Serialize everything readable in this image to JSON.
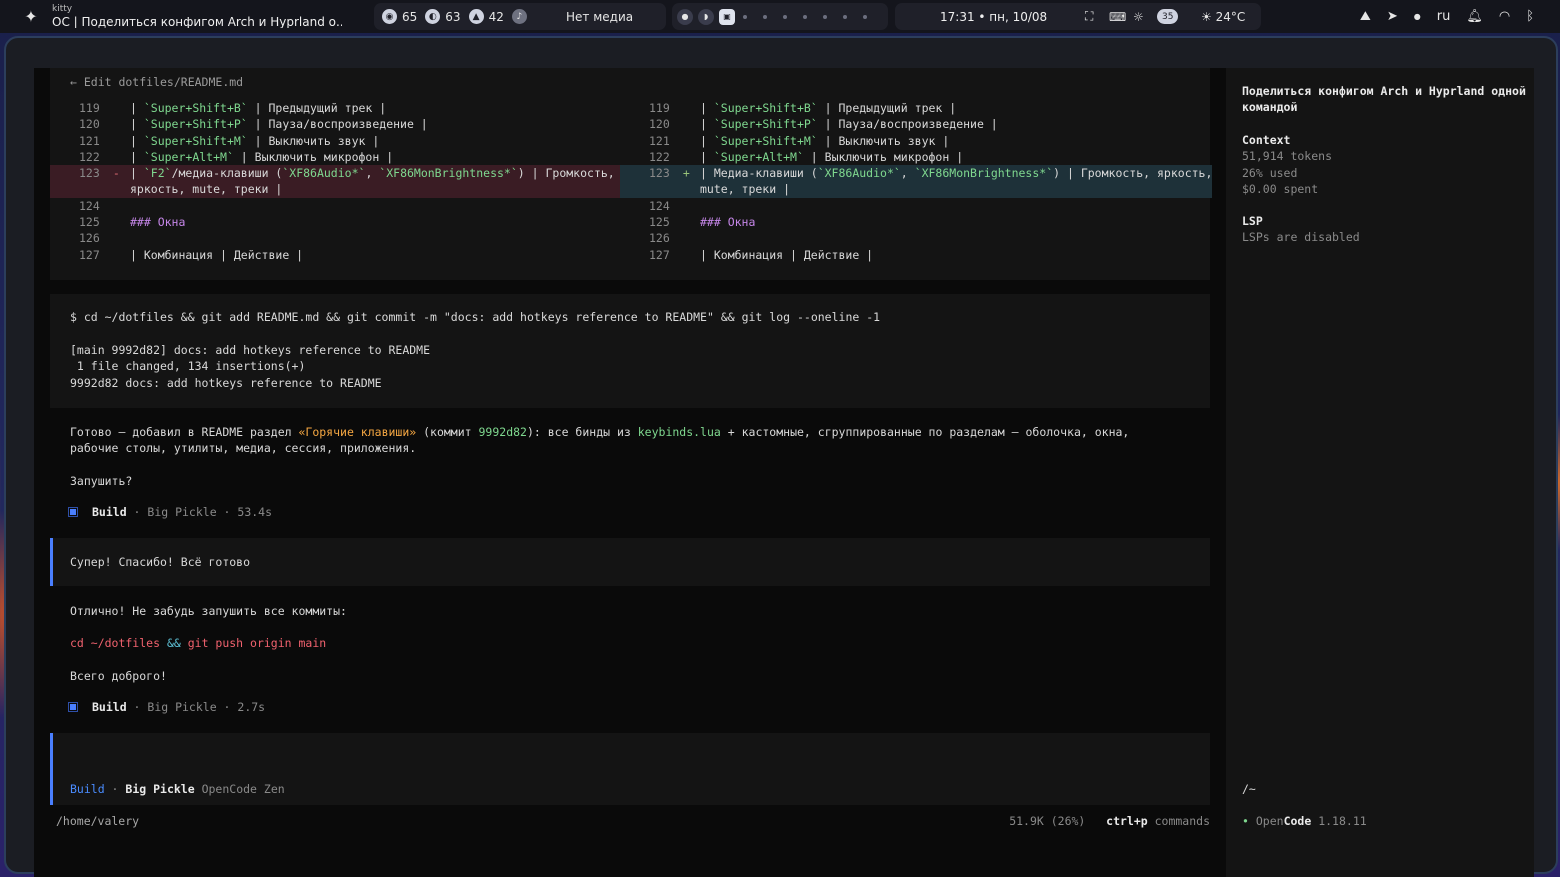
{
  "topbar": {
    "app_name": "kitty",
    "window_title": "ОС | Поделиться конфигом Arch и Hyprland о...",
    "stats": [
      {
        "icon": "cpu-icon",
        "value": "65"
      },
      {
        "icon": "memory-icon",
        "value": "63"
      },
      {
        "icon": "temperature-icon",
        "value": "42"
      }
    ],
    "media_text": "Нет медиа",
    "clock": "17:31 • пн, 10/08",
    "volume_level": "35",
    "weather": "☀ 24°C",
    "layout": "ru"
  },
  "diff": {
    "header": "← Edit dotfiles/README.md",
    "left": [
      {
        "num": "119",
        "sign": "",
        "parts": [
          [
            "| ",
            ""
          ],
          [
            "`Super+Shift+B`",
            "k"
          ],
          [
            " | Предыдущий трек |",
            ""
          ]
        ]
      },
      {
        "num": "120",
        "sign": "",
        "parts": [
          [
            "| ",
            ""
          ],
          [
            "`Super+Shift+P`",
            "k"
          ],
          [
            " | Пауза/воспроизведение |",
            ""
          ]
        ]
      },
      {
        "num": "121",
        "sign": "",
        "parts": [
          [
            "| ",
            ""
          ],
          [
            "`Super+Shift+M`",
            "k"
          ],
          [
            " | Выключить звук |",
            ""
          ]
        ]
      },
      {
        "num": "122",
        "sign": "",
        "parts": [
          [
            "| ",
            ""
          ],
          [
            "`Super+Alt+M`",
            "k"
          ],
          [
            " | Выключить микрофон |",
            ""
          ]
        ]
      },
      {
        "num": "123",
        "sign": "-",
        "type": "removed",
        "parts": [
          [
            "| ",
            ""
          ],
          [
            "`F2`",
            "k"
          ],
          [
            "/медиа-клавиши (",
            ""
          ],
          [
            "`XF86Audio*`",
            "k"
          ],
          [
            ", ",
            ""
          ],
          [
            "`XF86MonBrightness*`",
            "k"
          ],
          [
            ") | Громкость, яркость, mute, треки |",
            ""
          ]
        ]
      },
      {
        "num": "124",
        "sign": "",
        "parts": [
          [
            "",
            ""
          ]
        ]
      },
      {
        "num": "125",
        "sign": "",
        "parts": [
          [
            "### Окна",
            "h"
          ]
        ]
      },
      {
        "num": "126",
        "sign": "",
        "parts": [
          [
            "",
            ""
          ]
        ]
      },
      {
        "num": "127",
        "sign": "",
        "parts": [
          [
            "| Комбинация | Действие |",
            ""
          ]
        ]
      }
    ],
    "right": [
      {
        "num": "119",
        "sign": "",
        "parts": [
          [
            "| ",
            ""
          ],
          [
            "`Super+Shift+B`",
            "k"
          ],
          [
            " | Предыдущий трек |",
            ""
          ]
        ]
      },
      {
        "num": "120",
        "sign": "",
        "parts": [
          [
            "| ",
            ""
          ],
          [
            "`Super+Shift+P`",
            "k"
          ],
          [
            " | Пауза/воспроизведение |",
            ""
          ]
        ]
      },
      {
        "num": "121",
        "sign": "",
        "parts": [
          [
            "| ",
            ""
          ],
          [
            "`Super+Shift+M`",
            "k"
          ],
          [
            " | Выключить звук |",
            ""
          ]
        ]
      },
      {
        "num": "122",
        "sign": "",
        "parts": [
          [
            "| ",
            ""
          ],
          [
            "`Super+Alt+M`",
            "k"
          ],
          [
            " | Выключить микрофон |",
            ""
          ]
        ]
      },
      {
        "num": "123",
        "sign": "+",
        "type": "added",
        "parts": [
          [
            "| Медиа-клавиши (",
            ""
          ],
          [
            "`XF86Audio*`",
            "k"
          ],
          [
            ", ",
            ""
          ],
          [
            "`XF86MonBrightness*`",
            "k"
          ],
          [
            ") | Громкость, яркость, mute, треки |",
            ""
          ]
        ]
      },
      {
        "num": "124",
        "sign": "",
        "parts": [
          [
            "",
            ""
          ]
        ]
      },
      {
        "num": "125",
        "sign": "",
        "parts": [
          [
            "### Окна",
            "h"
          ]
        ]
      },
      {
        "num": "126",
        "sign": "",
        "parts": [
          [
            "",
            ""
          ]
        ]
      },
      {
        "num": "127",
        "sign": "",
        "parts": [
          [
            "| Комбинация | Действие |",
            ""
          ]
        ]
      }
    ]
  },
  "bash": {
    "command": "$ cd ~/dotfiles && git add README.md && git commit -m \"docs: add hotkeys reference to README\" && git log --oneline -1",
    "output": "[main 9992d82] docs: add hotkeys reference to README\n 1 file changed, 134 insertions(+)\n9992d82 docs: add hotkeys reference to README"
  },
  "assistant1": {
    "p1_a": "Готово — добавил в README раздел ",
    "p1_b": "«Горячие клавиши»",
    "p1_c": " (коммит ",
    "p1_d": "9992d82",
    "p1_e": "): все бинды из ",
    "p1_f": "keybinds.lua",
    "p1_g": " + кастомные, сгруппированные по разделам — оболочка, окна,",
    "p1_line2": "рабочие столы, утилиты, медиа, сессия, приложения.",
    "p2": "Запушить?",
    "build_label": "Build",
    "build_meta": " · Big Pickle · 53.4s"
  },
  "user_msg": "Супер! Спасибо! Всё готово",
  "assistant2": {
    "p1": "Отлично! Не забудь запушить все коммиты:",
    "cmd_a": "cd ~/dotfiles ",
    "cmd_b": "&&",
    "cmd_c": " git push origin main",
    "p3": "Всего доброго!",
    "build_label": "Build",
    "build_meta": " · Big Pickle · 2.7s"
  },
  "input": {
    "mode": "Build",
    "sep": " · ",
    "model": "Big Pickle",
    "provider": " OpenCode Zen"
  },
  "footer": {
    "cwd": "/home/valery",
    "usage": "51.9K (26%)",
    "shortcut": "ctrl+p",
    "shortcut_label": " commands"
  },
  "sidebar": {
    "title": "Поделиться конфигом Arch и Hyprland одной командой",
    "context_heading": "Context",
    "tokens": "51,914 tokens",
    "used": "26% used",
    "spent": "$0.00 spent",
    "lsp_heading": "LSP",
    "lsp_status": "LSPs are disabled",
    "path": "/~",
    "app_open": "Open",
    "app_code": "Code",
    "version": " 1.18.11"
  },
  "colors": {
    "accent_blue": "#4a7fff",
    "keyword_green": "#7fd88f",
    "heading_purple": "#c586e8",
    "highlight_orange": "#f5a742",
    "command_red": "#f0626e",
    "removed_bg": "#3a1c24",
    "added_bg": "#1e3139"
  }
}
